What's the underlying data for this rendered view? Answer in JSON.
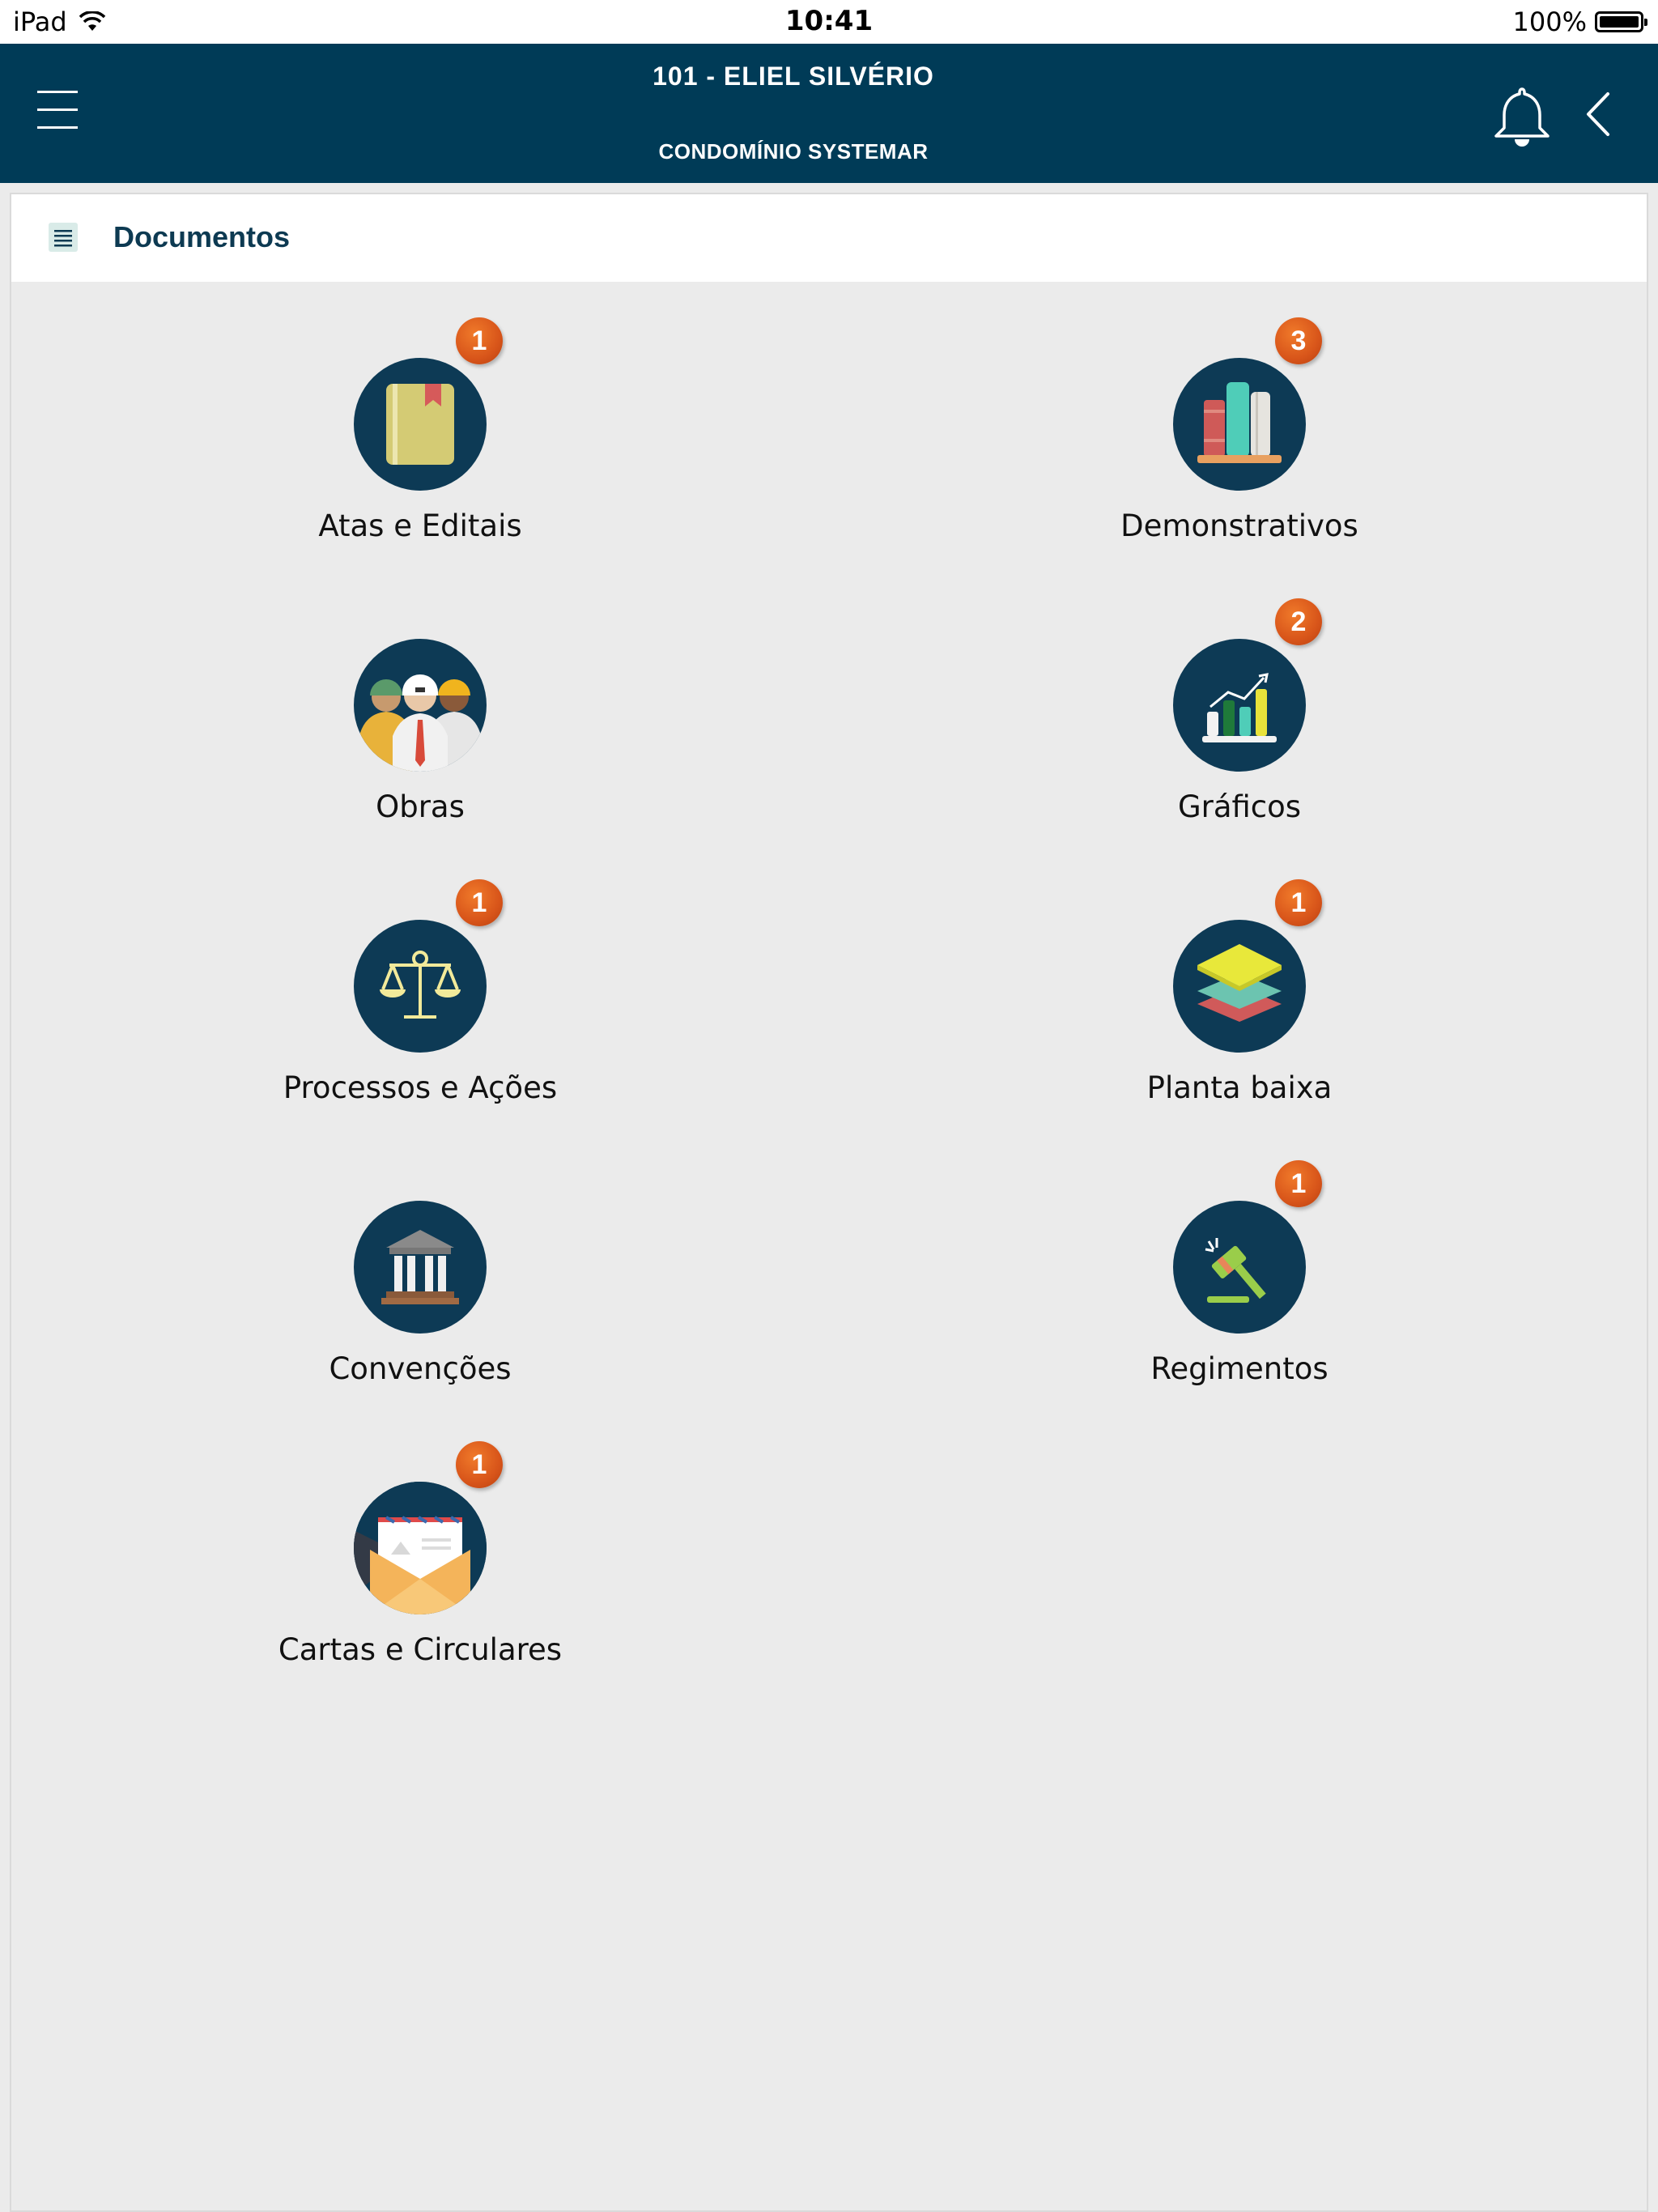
{
  "status_bar": {
    "device": "iPad",
    "time": "10:41",
    "battery": "100%"
  },
  "header": {
    "title": "101 - ELIEL SILVÉRIO",
    "subtitle": "CONDOMÍNIO SYSTEMAR"
  },
  "section": {
    "title": "Documentos"
  },
  "tiles": [
    {
      "label": "Atas e Editais",
      "badge": "1",
      "icon": "book-icon"
    },
    {
      "label": "Demonstrativos",
      "badge": "3",
      "icon": "books-icon"
    },
    {
      "label": "Obras",
      "badge": "",
      "icon": "workers-icon"
    },
    {
      "label": "Gráficos",
      "badge": "2",
      "icon": "bar-chart-icon"
    },
    {
      "label": "Processos e Ações",
      "badge": "1",
      "icon": "scales-icon"
    },
    {
      "label": "Planta baixa",
      "badge": "1",
      "icon": "layers-icon"
    },
    {
      "label": "Convenções",
      "badge": "",
      "icon": "courthouse-icon"
    },
    {
      "label": "Regimentos",
      "badge": "1",
      "icon": "gavel-icon"
    },
    {
      "label": "Cartas e Circulares",
      "badge": "1",
      "icon": "envelope-icon"
    }
  ],
  "colors": {
    "header_bg": "#003b57",
    "icon_circle": "#0d3a55",
    "badge": "#d8551a",
    "page_bg": "#ebebeb"
  }
}
